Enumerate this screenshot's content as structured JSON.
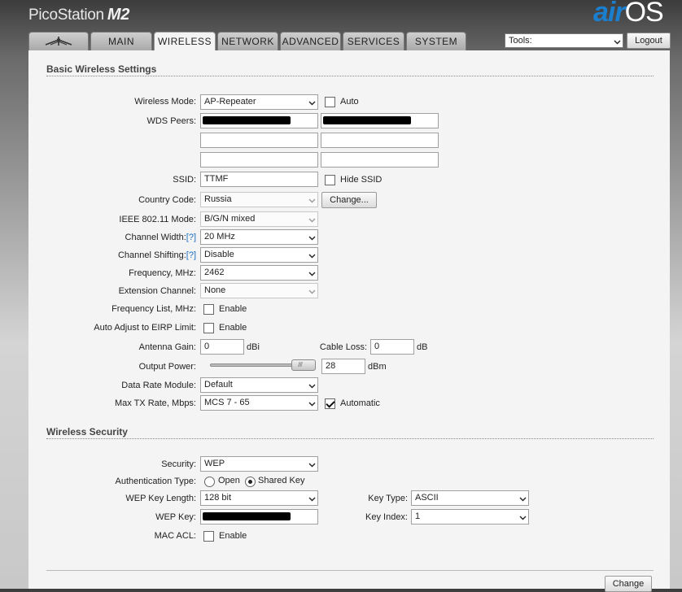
{
  "brand": {
    "name": "PicoStation",
    "model": "M2",
    "airos_air": "air",
    "airos_os": "OS"
  },
  "nav": {
    "tabs": [
      "MAIN",
      "WIRELESS",
      "NETWORK",
      "ADVANCED",
      "SERVICES",
      "SYSTEM"
    ],
    "active_tab": "WIRELESS",
    "tools_label": "Tools:",
    "logout_label": "Logout"
  },
  "basic": {
    "title": "Basic Wireless Settings",
    "wireless_mode": {
      "label": "Wireless Mode:",
      "value": "AP-Repeater",
      "auto_label": "Auto",
      "auto_checked": false
    },
    "wds_peers": {
      "label": "WDS Peers:"
    },
    "ssid": {
      "label": "SSID:",
      "value": "TTMF",
      "hide_label": "Hide SSID",
      "hide_checked": false
    },
    "country_code": {
      "label": "Country Code:",
      "value": "Russia",
      "change_label": "Change..."
    },
    "ieee_mode": {
      "label": "IEEE 802.11 Mode:",
      "value": "B/G/N mixed"
    },
    "channel_width": {
      "label": "Channel Width:",
      "help": "[?]",
      "value": "20 MHz"
    },
    "channel_shifting": {
      "label": "Channel Shifting:",
      "help": "[?]",
      "value": "Disable"
    },
    "frequency": {
      "label": "Frequency, MHz:",
      "value": "2462"
    },
    "extension_channel": {
      "label": "Extension Channel:",
      "value": "None"
    },
    "frequency_list": {
      "label": "Frequency List, MHz:",
      "enable_label": "Enable",
      "checked": false
    },
    "auto_eirp": {
      "label": "Auto Adjust to EIRP Limit:",
      "enable_label": "Enable",
      "checked": false
    },
    "antenna_gain": {
      "label": "Antenna Gain:",
      "value": "0",
      "unit": "dBi"
    },
    "cable_loss": {
      "label": "Cable Loss:",
      "value": "0",
      "unit": "dB"
    },
    "output_power": {
      "label": "Output Power:",
      "value": "28",
      "unit": "dBm",
      "slider_fraction": 1.0
    },
    "data_rate_module": {
      "label": "Data Rate Module:",
      "value": "Default"
    },
    "max_tx_rate": {
      "label": "Max TX Rate, Mbps:",
      "value": "MCS 7 - 65",
      "automatic_label": "Automatic",
      "automatic_checked": true
    }
  },
  "security": {
    "title": "Wireless Security",
    "security": {
      "label": "Security:",
      "value": "WEP"
    },
    "auth_type": {
      "label": "Authentication Type:",
      "open_label": "Open",
      "shared_label": "Shared Key",
      "selected": "Shared Key"
    },
    "wep_key_length": {
      "label": "WEP Key Length:",
      "value": "128 bit"
    },
    "key_type": {
      "label": "Key Type:",
      "value": "ASCII"
    },
    "wep_key": {
      "label": "WEP Key:"
    },
    "key_index": {
      "label": "Key Index:",
      "value": "1"
    },
    "mac_acl": {
      "label": "MAC ACL:",
      "enable_label": "Enable",
      "checked": false
    }
  },
  "footer": {
    "change_label": "Change"
  }
}
